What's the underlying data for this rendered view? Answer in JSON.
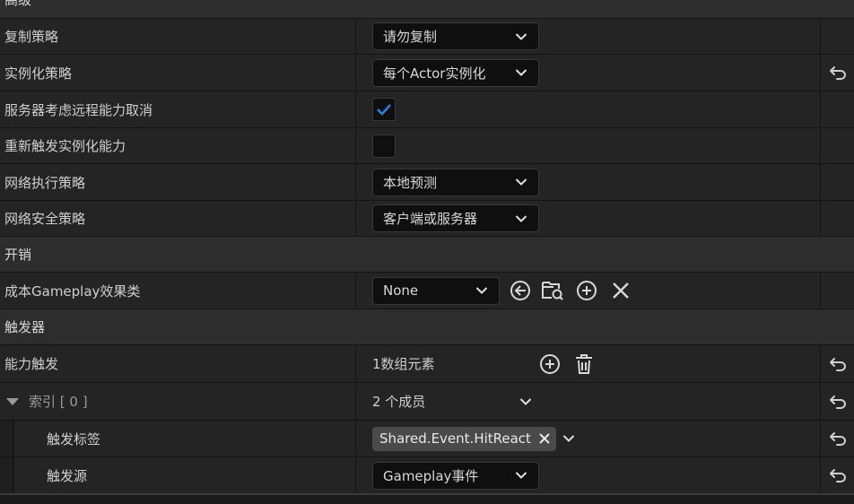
{
  "sections": {
    "advanced": {
      "title": "高级"
    },
    "cost": {
      "title": "开销"
    },
    "triggers": {
      "title": "触发器"
    }
  },
  "properties": {
    "replication_policy": {
      "label": "复制策略",
      "value": "请勿复制"
    },
    "instancing_policy": {
      "label": "实例化策略",
      "value": "每个Actor实例化"
    },
    "server_respects_remote_cancel": {
      "label": "服务器考虑远程能力取消",
      "checked": true
    },
    "retrigger_instanced": {
      "label": "重新触发实例化能力",
      "checked": false
    },
    "net_execution_policy": {
      "label": "网络执行策略",
      "value": "本地预测"
    },
    "net_security_policy": {
      "label": "网络安全策略",
      "value": "客户端或服务器"
    },
    "cost_gameplay_effect_class": {
      "label": "成本Gameplay效果类",
      "value": "None"
    },
    "ability_triggers": {
      "label": "能力触发",
      "value": "1数组元素"
    },
    "index0": {
      "label": "索引 [ 0 ]",
      "value": "2 个成员"
    },
    "trigger_tag": {
      "label": "触发标签",
      "value": "Shared.Event.HitReact"
    },
    "trigger_source": {
      "label": "触发源",
      "value": "Gameplay事件"
    }
  },
  "colors": {
    "accent_check": "#2f7de1",
    "row_bg": "#242424",
    "category_bg": "#2d2d2d"
  },
  "icons": [
    "chevron-down-icon",
    "reset-arrow-icon",
    "checkmark-icon",
    "browse-back-icon",
    "browse-folder-icon",
    "add-circle-icon",
    "clear-x-icon",
    "trash-icon",
    "expand-triangle-icon",
    "tag-remove-icon"
  ]
}
